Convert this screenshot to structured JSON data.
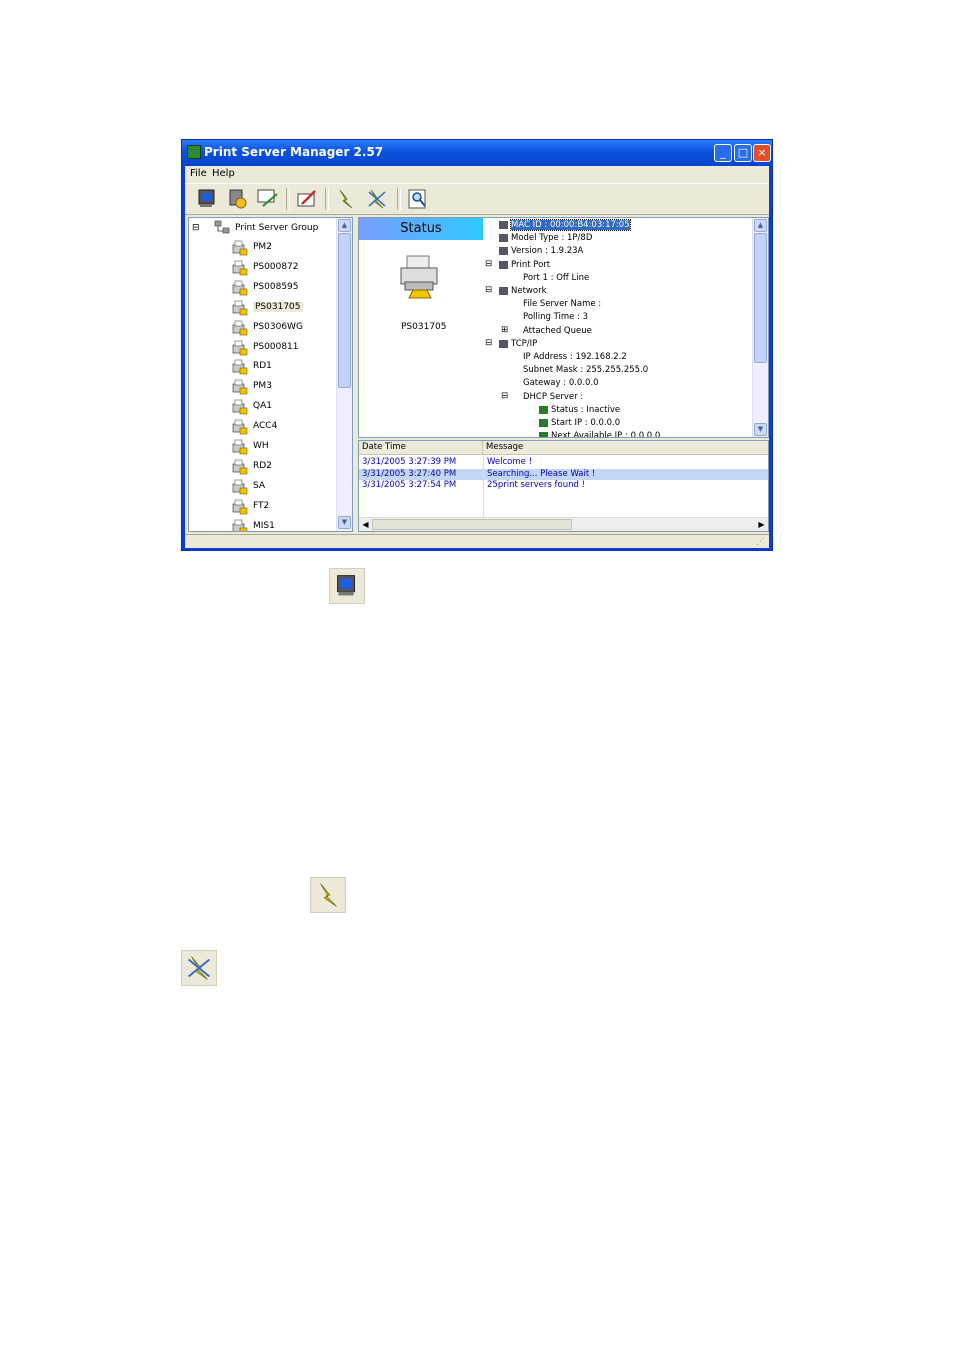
{
  "window": {
    "title": "Print Server Manager 2.57",
    "controls": [
      "minimize",
      "maximize",
      "close"
    ]
  },
  "menu": [
    "File",
    "Help"
  ],
  "toolbar": {
    "tools": [
      "monitor-icon",
      "settings-icon",
      "search-network-icon",
      "edit-icon",
      "lightning-icon",
      "lightning-cross-icon",
      "magnifier-icon"
    ]
  },
  "tree": {
    "root": "Print Server Group",
    "items": [
      "PM2",
      "PS000872",
      "PS008595",
      "PS031705",
      "PS0306WG",
      "PS000811",
      "RD1",
      "PM3",
      "QA1",
      "ACC4",
      "WH",
      "RD2",
      "SA",
      "FT2",
      "MIS1"
    ],
    "selected": "PS031705"
  },
  "status": {
    "header": "Status",
    "device_name": "PS031705"
  },
  "properties": [
    {
      "text": "MAC ID : 00:00:B4:03:17:05",
      "selected": true
    },
    {
      "text": "Model Type : 1P/8D"
    },
    {
      "text": "Version : 1.9.23A"
    },
    {
      "text": "Print Port"
    },
    {
      "text": "Port 1 : Off Line"
    },
    {
      "text": "Network"
    },
    {
      "text": "File Server Name :"
    },
    {
      "text": "Polling Time : 3"
    },
    {
      "text": "Attached Queue"
    },
    {
      "text": "TCP/IP"
    },
    {
      "text": "IP Address : 192.168.2.2"
    },
    {
      "text": "Subnet Mask : 255.255.255.0"
    },
    {
      "text": "Gateway : 0.0.0.0"
    },
    {
      "text": "DHCP Server :"
    },
    {
      "text": "Status : Inactive"
    },
    {
      "text": "Start IP : 0.0.0.0"
    },
    {
      "text": "Next Available IP : 0.0.0.0"
    }
  ],
  "log": {
    "columns": [
      "Date Time",
      "Message"
    ],
    "rows": [
      {
        "time": "3/31/2005 3:27:39 PM",
        "message": "Welcome !"
      },
      {
        "time": "3/31/2005 3:27:40 PM",
        "message": "Searching... Please Wait !"
      },
      {
        "time": "3/31/2005 3:27:54 PM",
        "message": "25print servers found !"
      }
    ]
  },
  "standalone_icons": [
    "monitor-icon",
    "lightning-icon",
    "lightning-cross-icon"
  ]
}
